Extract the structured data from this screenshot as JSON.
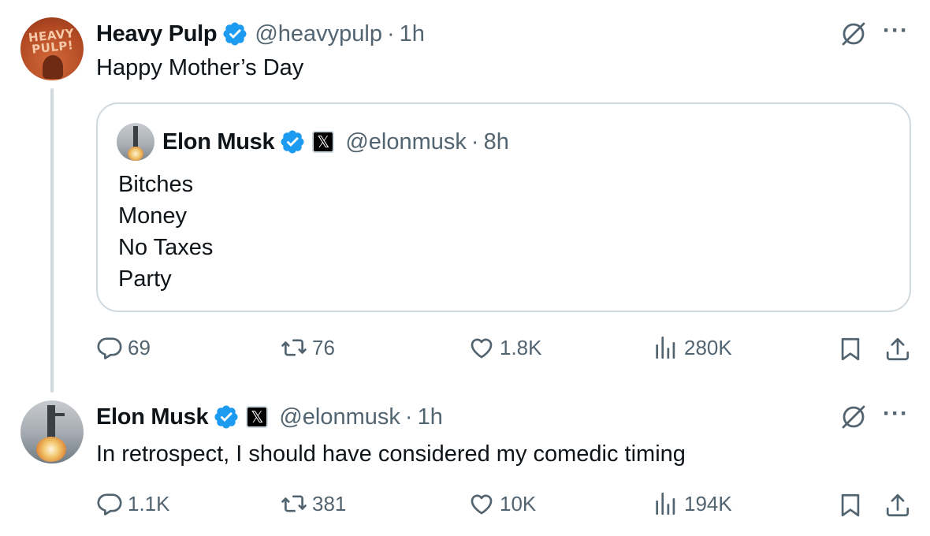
{
  "thread": [
    {
      "name": "Heavy Pulp",
      "handle": "@heavypulp",
      "time": "1h",
      "text": "Happy Mother’s Day",
      "avatar_text": [
        "HEAVY",
        "PULP!"
      ],
      "quote": {
        "name": "Elon Musk",
        "handle": "@elonmusk",
        "time": "8h",
        "lines": [
          "Bitches",
          "Money",
          "No Taxes",
          "Party"
        ]
      },
      "stats": {
        "replies": "69",
        "reposts": "76",
        "likes": "1.8K",
        "views": "280K"
      }
    },
    {
      "name": "Elon Musk",
      "handle": "@elonmusk",
      "time": "1h",
      "text": "In retrospect, I should have considered my comedic timing",
      "stats": {
        "replies": "1.1K",
        "reposts": "381",
        "likes": "10K",
        "views": "194K"
      }
    }
  ],
  "ui": {
    "separator": "·",
    "more": "···",
    "x_badge": "𝕏"
  },
  "colors": {
    "verified": "#1d9bf0",
    "muted": "#536471",
    "text": "#0f1419",
    "border": "#cfd9de"
  },
  "icons": [
    "grok-icon",
    "more-icon",
    "reply-icon",
    "repost-icon",
    "like-icon",
    "views-icon",
    "bookmark-icon",
    "share-icon",
    "verified-icon",
    "x-badge-icon"
  ]
}
